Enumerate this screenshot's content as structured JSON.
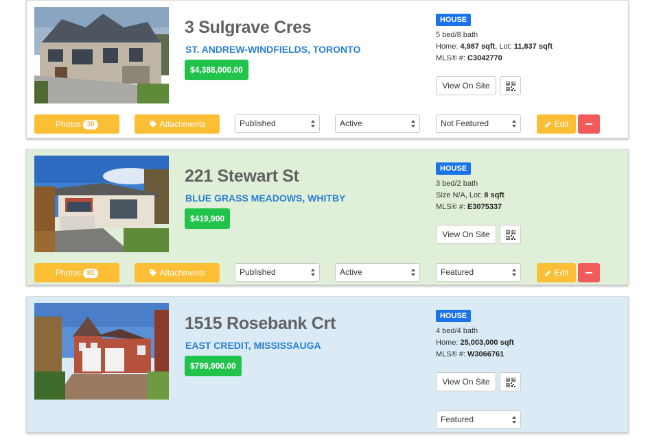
{
  "colors": {
    "house_badge": "#1a73e8",
    "price_bg": "#22c34c",
    "area_link": "#2a7fd4",
    "yellow_btn": "#fbbe35",
    "delete_btn": "#f15b5b"
  },
  "listings": [
    {
      "title": "3 Sulgrave Cres",
      "area": "ST. ANDREW-WINDFIELDS, TORONTO",
      "price": "$4,388,000.00",
      "type": "HOUSE",
      "beds_baths": "5 bed/8 bath",
      "size_prefix": "Home: ",
      "size_home": "4,987 sqft",
      "size_mid": ", Lot: ",
      "size_lot": "11,837 sqft",
      "mls_label": "MLS® #: ",
      "mls": "C3042770",
      "view_label": "View On Site",
      "photos_label": "Photos",
      "photos_count": "38",
      "attachments_label": "Attachments",
      "published": "Published",
      "status": "Active",
      "featured": "Not Featured",
      "edit_label": "Edit"
    },
    {
      "title": "221 Stewart St",
      "area": "BLUE GRASS MEADOWS, WHITBY",
      "price": "$419,900",
      "type": "HOUSE",
      "beds_baths": "3 bed/2 bath",
      "size_prefix": "Size N/A, Lot: ",
      "size_home": "",
      "size_mid": "",
      "size_lot": "8 sqft",
      "mls_label": "MLS® #: ",
      "mls": "E3075337",
      "view_label": "View On Site",
      "photos_label": "Photos",
      "photos_count": "80",
      "attachments_label": "Attachments",
      "published": "Published",
      "status": "Active",
      "featured": "Featured",
      "edit_label": "Edit"
    },
    {
      "title": "1515 Rosebank Crt",
      "area": "EAST CREDIT, MISSISSAUGA",
      "price": "$799,900.00",
      "type": "HOUSE",
      "beds_baths": "4 bed/4 bath",
      "size_prefix": "Home: ",
      "size_home": "25,003,000 sqft",
      "size_mid": "",
      "size_lot": "",
      "mls_label": "MLS® #: ",
      "mls": "W3066761",
      "view_label": "View On Site",
      "featured": "Featured"
    }
  ]
}
